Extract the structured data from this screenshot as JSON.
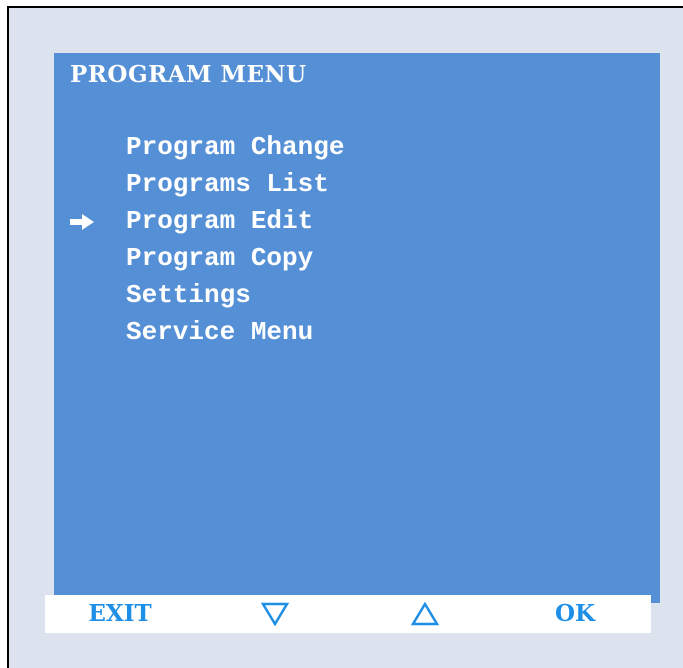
{
  "screen": {
    "title": "PROGRAM MENU",
    "background_color": "#5590d6",
    "text_color": "#ffffff"
  },
  "menu": {
    "selected_index": 2,
    "items": [
      {
        "label": "Program Change"
      },
      {
        "label": "Programs List"
      },
      {
        "label": "Program Edit"
      },
      {
        "label": "Program Copy"
      },
      {
        "label": "Settings"
      },
      {
        "label": "Service Menu"
      }
    ],
    "selection_icon": "arrow-right-icon"
  },
  "softkeys": {
    "color": "#1e8fe6",
    "exit_label": "EXIT",
    "down_icon": "triangle-down-icon",
    "up_icon": "triangle-up-icon",
    "ok_label": "OK"
  }
}
